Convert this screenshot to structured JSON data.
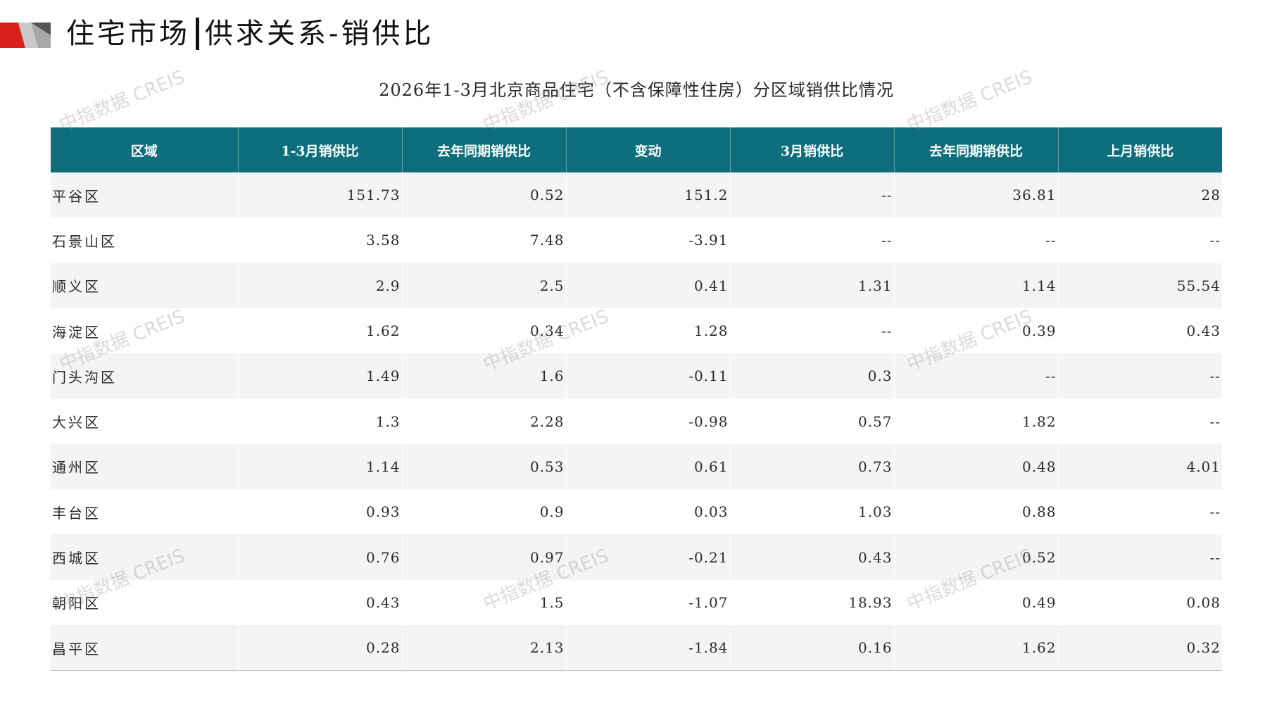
{
  "header": {
    "title_part1": "住宅市场",
    "title_part2": "供求关系-销供比"
  },
  "caption": "2026年1-3月北京商品住宅（不含保障性住房）分区域销供比情况",
  "watermark_text": "中指数据 CREIS",
  "colors": {
    "header_bg": "#0e6e7c",
    "logo_red": "#d9201d",
    "logo_gray": "#a7a7a7",
    "row_alt": "#f3f4f6"
  },
  "table": {
    "columns": [
      "区域",
      "1-3月销供比",
      "去年同期销供比",
      "变动",
      "3月销供比",
      "去年同期销供比",
      "上月销供比"
    ],
    "rows": [
      [
        "平谷区",
        "151.73",
        "0.52",
        "151.2",
        "--",
        "36.81",
        "28"
      ],
      [
        "石景山区",
        "3.58",
        "7.48",
        "-3.91",
        "--",
        "--",
        "--"
      ],
      [
        "顺义区",
        "2.9",
        "2.5",
        "0.41",
        "1.31",
        "1.14",
        "55.54"
      ],
      [
        "海淀区",
        "1.62",
        "0.34",
        "1.28",
        "--",
        "0.39",
        "0.43"
      ],
      [
        "门头沟区",
        "1.49",
        "1.6",
        "-0.11",
        "0.3",
        "--",
        "--"
      ],
      [
        "大兴区",
        "1.3",
        "2.28",
        "-0.98",
        "0.57",
        "1.82",
        "--"
      ],
      [
        "通州区",
        "1.14",
        "0.53",
        "0.61",
        "0.73",
        "0.48",
        "4.01"
      ],
      [
        "丰台区",
        "0.93",
        "0.9",
        "0.03",
        "1.03",
        "0.88",
        "--"
      ],
      [
        "西城区",
        "0.76",
        "0.97",
        "-0.21",
        "0.43",
        "0.52",
        "--"
      ],
      [
        "朝阳区",
        "0.43",
        "1.5",
        "-1.07",
        "18.93",
        "0.49",
        "0.08"
      ],
      [
        "昌平区",
        "0.28",
        "2.13",
        "-1.84",
        "0.16",
        "1.62",
        "0.32"
      ]
    ]
  }
}
